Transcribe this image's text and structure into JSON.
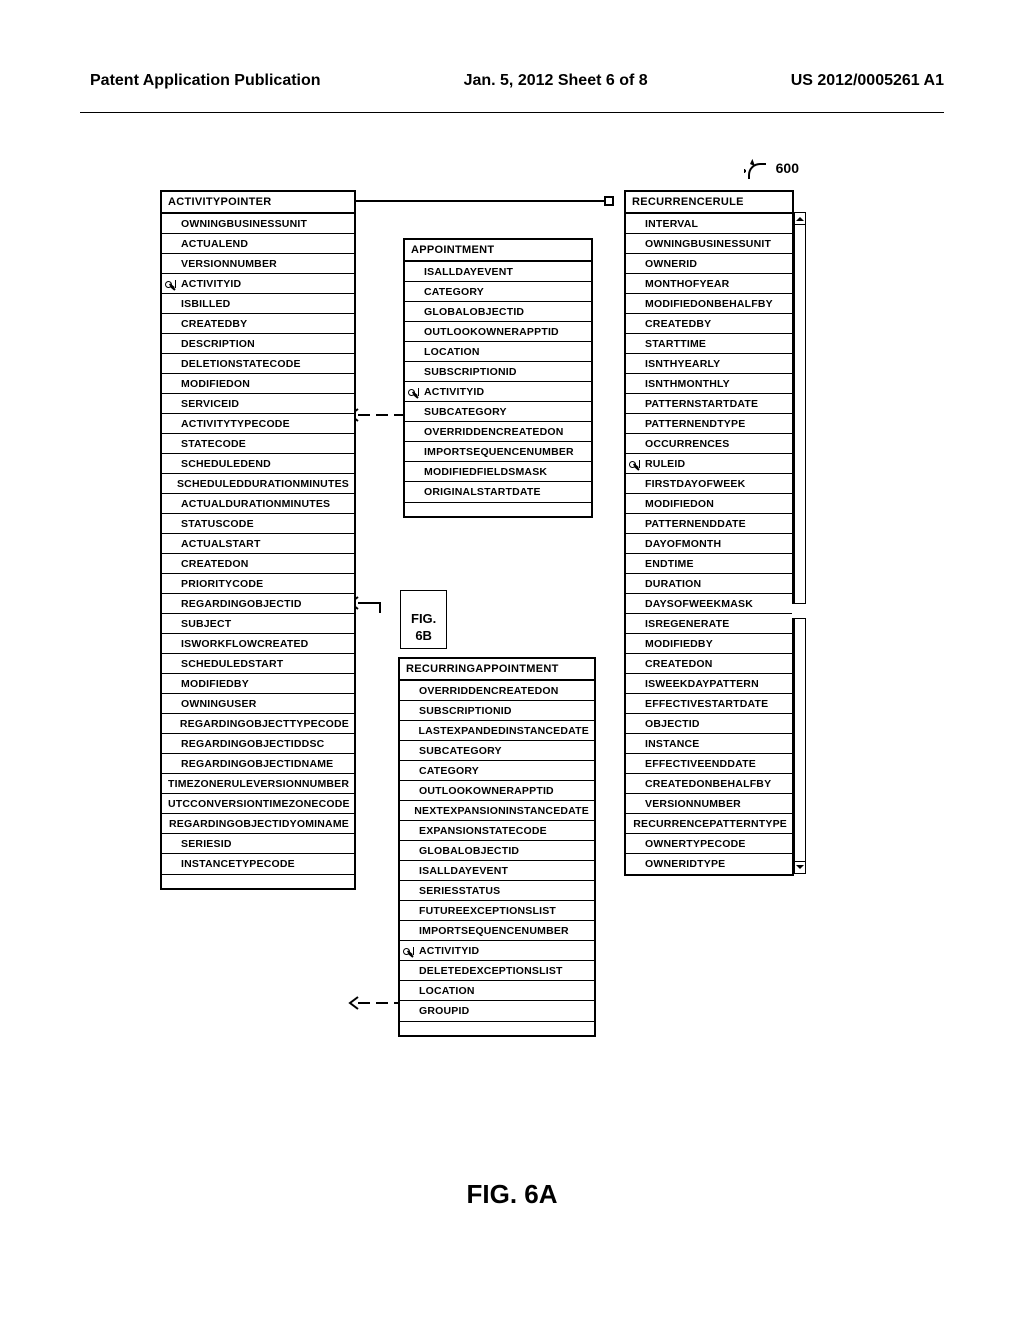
{
  "header": {
    "left": "Patent Application Publication",
    "center": "Jan. 5, 2012   Sheet 6 of 8",
    "right": "US 2012/0005261 A1"
  },
  "ref_label": "600",
  "fig_small": "FIG.\n6B",
  "fig_main": "FIG. 6A",
  "entities": {
    "activitypointer": {
      "title": "ACTIVITYPOINTER",
      "fields": [
        {
          "key": false,
          "name": "OWNINGBUSINESSUNIT"
        },
        {
          "key": false,
          "name": "ACTUALEND"
        },
        {
          "key": false,
          "name": "VERSIONNUMBER"
        },
        {
          "key": true,
          "name": "ACTIVITYID"
        },
        {
          "key": false,
          "name": "ISBILLED"
        },
        {
          "key": false,
          "name": "CREATEDBY"
        },
        {
          "key": false,
          "name": "DESCRIPTION"
        },
        {
          "key": false,
          "name": "DELETIONSTATECODE"
        },
        {
          "key": false,
          "name": "MODIFIEDON"
        },
        {
          "key": false,
          "name": "SERVICEID"
        },
        {
          "key": false,
          "name": "ACTIVITYTYPECODE"
        },
        {
          "key": false,
          "name": "STATECODE"
        },
        {
          "key": false,
          "name": "SCHEDULEDEND"
        },
        {
          "key": false,
          "name": "SCHEDULEDDURATIONMINUTES"
        },
        {
          "key": false,
          "name": "ACTUALDURATIONMINUTES"
        },
        {
          "key": false,
          "name": "STATUSCODE"
        },
        {
          "key": false,
          "name": "ACTUALSTART"
        },
        {
          "key": false,
          "name": "CREATEDON"
        },
        {
          "key": false,
          "name": "PRIORITYCODE"
        },
        {
          "key": false,
          "name": "REGARDINGOBJECTID"
        },
        {
          "key": false,
          "name": "SUBJECT"
        },
        {
          "key": false,
          "name": "ISWORKFLOWCREATED"
        },
        {
          "key": false,
          "name": "SCHEDULEDSTART"
        },
        {
          "key": false,
          "name": "MODIFIEDBY"
        },
        {
          "key": false,
          "name": "OWNINGUSER"
        },
        {
          "key": false,
          "name": "REGARDINGOBJECTTYPECODE"
        },
        {
          "key": false,
          "name": "REGARDINGOBJECTIDDSC"
        },
        {
          "key": false,
          "name": "REGARDINGOBJECTIDNAME"
        },
        {
          "key": false,
          "name": "TIMEZONERULEVERSIONNUMBER"
        },
        {
          "key": false,
          "name": "UTCCONVERSIONTIMEZONECODE"
        },
        {
          "key": false,
          "name": "REGARDINGOBJECTIDYOMINAME"
        },
        {
          "key": false,
          "name": "SERIESID"
        },
        {
          "key": false,
          "name": "INSTANCETYPECODE"
        }
      ]
    },
    "appointment": {
      "title": "APPOINTMENT",
      "fields": [
        {
          "key": false,
          "name": "ISALLDAYEVENT"
        },
        {
          "key": false,
          "name": "CATEGORY"
        },
        {
          "key": false,
          "name": "GLOBALOBJECTID"
        },
        {
          "key": false,
          "name": "OUTLOOKOWNERAPPTID"
        },
        {
          "key": false,
          "name": "LOCATION"
        },
        {
          "key": false,
          "name": "SUBSCRIPTIONID"
        },
        {
          "key": true,
          "name": "ACTIVITYID"
        },
        {
          "key": false,
          "name": "SUBCATEGORY"
        },
        {
          "key": false,
          "name": "OVERRIDDENCREATEDON"
        },
        {
          "key": false,
          "name": "IMPORTSEQUENCENUMBER"
        },
        {
          "key": false,
          "name": "MODIFIEDFIELDSMASK"
        },
        {
          "key": false,
          "name": "ORIGINALSTARTDATE"
        }
      ]
    },
    "recurringappointment": {
      "title": "RECURRINGAPPOINTMENT",
      "fields": [
        {
          "key": false,
          "name": "OVERRIDDENCREATEDON"
        },
        {
          "key": false,
          "name": "SUBSCRIPTIONID"
        },
        {
          "key": false,
          "name": "LASTEXPANDEDINSTANCEDATE"
        },
        {
          "key": false,
          "name": "SUBCATEGORY"
        },
        {
          "key": false,
          "name": "CATEGORY"
        },
        {
          "key": false,
          "name": "OUTLOOKOWNERAPPTID"
        },
        {
          "key": false,
          "name": "NEXTEXPANSIONINSTANCEDATE"
        },
        {
          "key": false,
          "name": "EXPANSIONSTATECODE"
        },
        {
          "key": false,
          "name": "GLOBALOBJECTID"
        },
        {
          "key": false,
          "name": "ISALLDAYEVENT"
        },
        {
          "key": false,
          "name": "SERIESSTATUS"
        },
        {
          "key": false,
          "name": "FUTUREEXCEPTIONSLIST"
        },
        {
          "key": false,
          "name": "IMPORTSEQUENCENUMBER"
        },
        {
          "key": true,
          "name": "ACTIVITYID"
        },
        {
          "key": false,
          "name": "DELETEDEXCEPTIONSLIST"
        },
        {
          "key": false,
          "name": "LOCATION"
        },
        {
          "key": false,
          "name": "GROUPID"
        }
      ]
    },
    "recurrencerule": {
      "title": "RECURRENCERULE",
      "fields": [
        {
          "key": false,
          "name": "INTERVAL"
        },
        {
          "key": false,
          "name": "OWNINGBUSINESSUNIT"
        },
        {
          "key": false,
          "name": "OWNERID"
        },
        {
          "key": false,
          "name": "MONTHOFYEAR"
        },
        {
          "key": false,
          "name": "MODIFIEDONBEHALFBY"
        },
        {
          "key": false,
          "name": "CREATEDBY"
        },
        {
          "key": false,
          "name": "STARTTIME"
        },
        {
          "key": false,
          "name": "ISNTHYEARLY"
        },
        {
          "key": false,
          "name": "ISNTHMONTHLY"
        },
        {
          "key": false,
          "name": "PATTERNSTARTDATE"
        },
        {
          "key": false,
          "name": "PATTERNENDTYPE"
        },
        {
          "key": false,
          "name": "OCCURRENCES"
        },
        {
          "key": true,
          "name": "RULEID"
        },
        {
          "key": false,
          "name": "FIRSTDAYOFWEEK"
        },
        {
          "key": false,
          "name": "MODIFIEDON"
        },
        {
          "key": false,
          "name": "PATTERNENDDATE"
        },
        {
          "key": false,
          "name": "DAYOFMONTH"
        },
        {
          "key": false,
          "name": "ENDTIME"
        },
        {
          "key": false,
          "name": "DURATION"
        },
        {
          "key": false,
          "name": "DAYSOFWEEKMASK"
        },
        {
          "key": false,
          "name": "ISREGENERATE"
        },
        {
          "key": false,
          "name": "MODIFIEDBY"
        },
        {
          "key": false,
          "name": "CREATEDON"
        },
        {
          "key": false,
          "name": "ISWEEKDAYPATTERN"
        },
        {
          "key": false,
          "name": "EFFECTIVESTARTDATE"
        },
        {
          "key": false,
          "name": "OBJECTID"
        },
        {
          "key": false,
          "name": "INSTANCE"
        },
        {
          "key": false,
          "name": "EFFECTIVEENDDATE"
        },
        {
          "key": false,
          "name": "CREATEDONBEHALFBY"
        },
        {
          "key": false,
          "name": "VERSIONNUMBER"
        },
        {
          "key": false,
          "name": "RECURRENCEPATTERNTYPE"
        },
        {
          "key": false,
          "name": "OWNERTYPECODE"
        },
        {
          "key": false,
          "name": "OWNERIDTYPE"
        }
      ]
    }
  }
}
